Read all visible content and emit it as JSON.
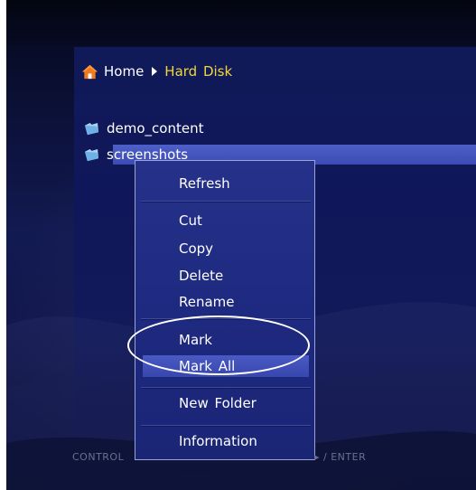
{
  "breadcrumb": {
    "home_label": "Home",
    "current_label": "Hard Disk",
    "home_icon": "home-icon",
    "separator_icon": "chevron-right-icon"
  },
  "file_list": {
    "items": [
      {
        "label": "demo_content",
        "icon": "folder-icon",
        "selected": false
      },
      {
        "label": "screenshots",
        "icon": "folder-icon",
        "selected": true
      }
    ]
  },
  "context_menu": {
    "items": [
      {
        "label": "Refresh"
      },
      {
        "label": "Cut"
      },
      {
        "label": "Copy"
      },
      {
        "label": "Delete"
      },
      {
        "label": "Rename"
      },
      {
        "label": "Mark"
      },
      {
        "label": "Mark All",
        "highlighted": true
      },
      {
        "label": "New Folder"
      },
      {
        "label": "Information"
      }
    ]
  },
  "help_bar": {
    "left_text": "CONTROL",
    "right_text": "▸ / ENTER"
  },
  "colors": {
    "breadcrumb_current": "#f3d63a",
    "selection": "#4e5fc8",
    "menu_background": "#263189",
    "menu_border": "#9aa3d6",
    "annotation": "#ffffff"
  }
}
